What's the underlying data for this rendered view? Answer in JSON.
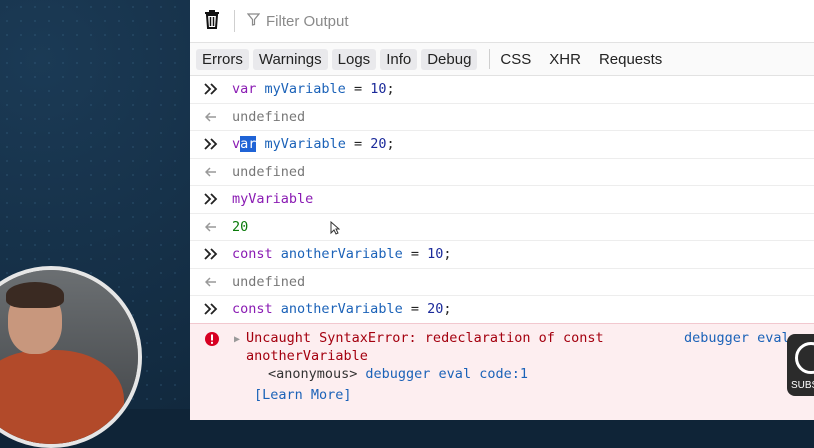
{
  "toolbar": {
    "filter_placeholder": "Filter Output",
    "trash_icon": "trash-icon",
    "filter_icon": "filter-icon"
  },
  "tabs": {
    "levels": [
      "Errors",
      "Warnings",
      "Logs",
      "Info",
      "Debug"
    ],
    "types": [
      "CSS",
      "XHR",
      "Requests"
    ]
  },
  "console": {
    "r1": {
      "kw": "var",
      "name": "myVariable",
      "op": " = ",
      "val": "10",
      "end": ";"
    },
    "r2": "undefined",
    "r3": {
      "pre": "v",
      "sel": "ar",
      "name": "myVariable",
      "op": " = ",
      "val": "20",
      "end": ";"
    },
    "r4": "undefined",
    "r5": "myVariable",
    "r6": "20",
    "r7": {
      "kw": "const",
      "name": "anotherVariable",
      "op": " = ",
      "val": "10",
      "end": ";"
    },
    "r8": "undefined",
    "r9": {
      "kw": "const",
      "name": "anotherVariable",
      "op": " = ",
      "val": "20",
      "end": ";"
    },
    "error": {
      "line1": "Uncaught SyntaxError: redeclaration of const",
      "line2": "anotherVariable",
      "frame": "<anonymous>",
      "frame_loc": "debugger eval code:1",
      "learn_more": "[Learn More]",
      "source": "debugger eval code"
    }
  },
  "overlay": {
    "subscribe_text": "SUBS"
  },
  "colors": {
    "error_bg": "#fdeef0",
    "error_text": "#a4000f",
    "link": "#1b62b8",
    "keyword": "#8a1bb3",
    "selection": "#1f63d6"
  }
}
